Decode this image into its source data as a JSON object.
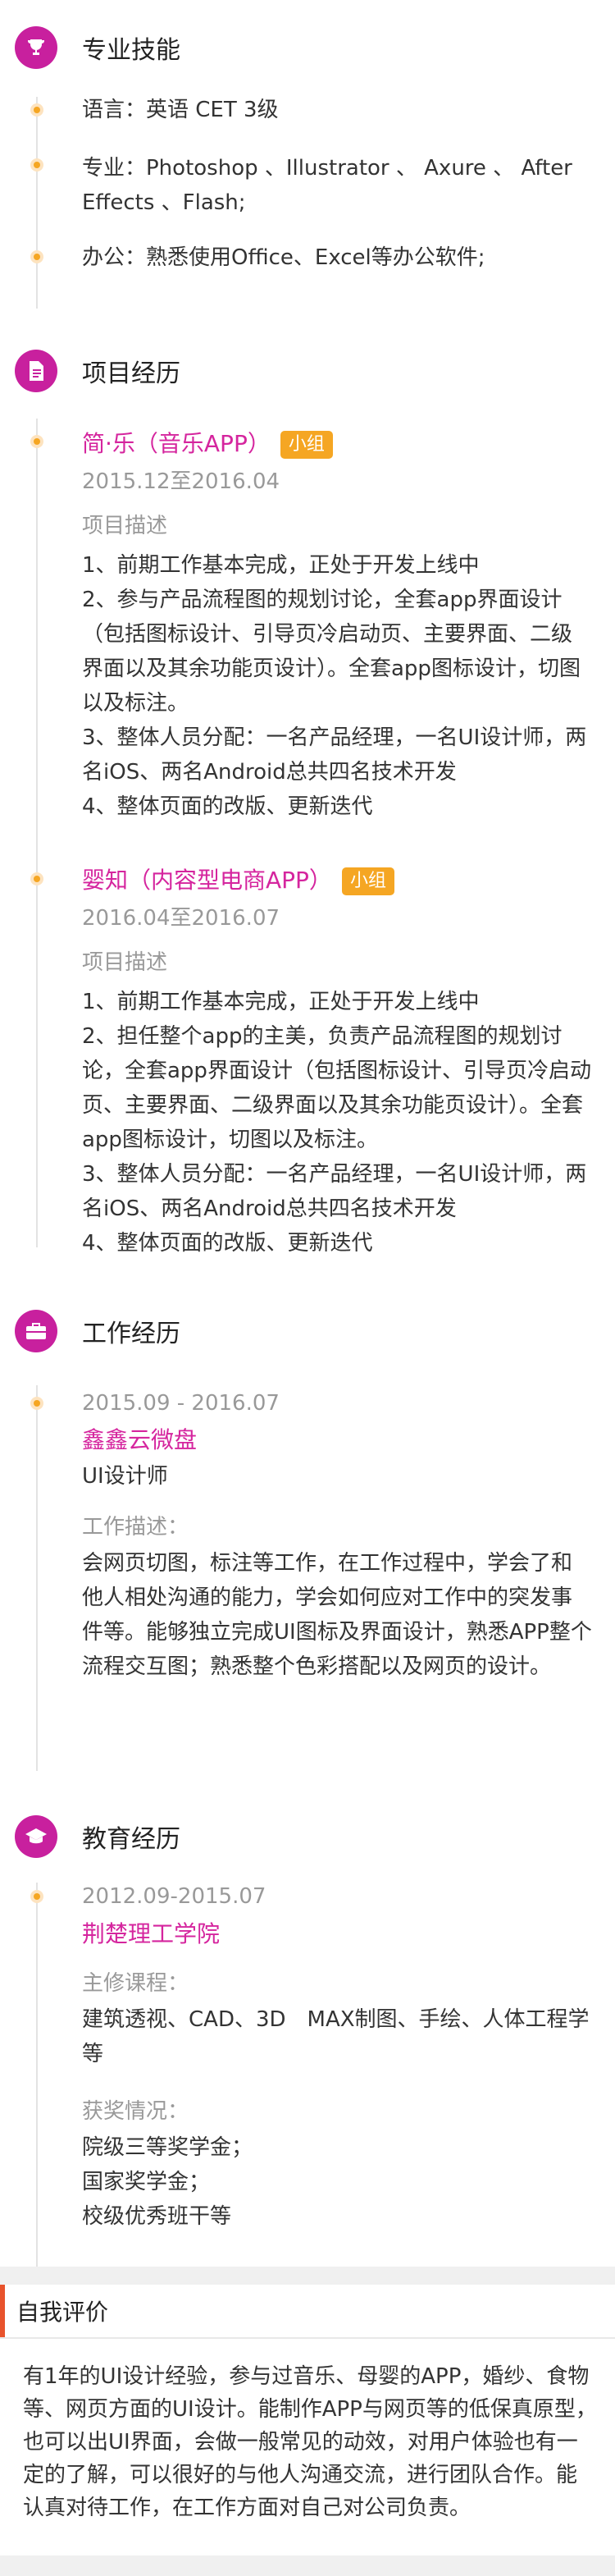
{
  "skills": {
    "title": "专业技能",
    "icon": "trophy-icon",
    "items": [
      "语言：英语  CET 3级",
      "专业：Photoshop 、Illustrator 、 Axure 、 After Effects 、Flash;",
      "办公：熟悉使用Office、Excel等办公软件;"
    ]
  },
  "projects": {
    "title": "项目经历",
    "icon": "document-icon",
    "items": [
      {
        "name": "简·乐（音乐APP）",
        "tag": "小组",
        "date": "2015.12至2016.04",
        "desc_label": "项目描述",
        "lines": [
          "1、前期工作基本完成，正处于开发上线中",
          "2、参与产品流程图的规划讨论，全套app界面设计（包括图标设计、引导页冷启动页、主要界面、二级界面以及其余功能页设计）。全套app图标设计，切图以及标注。",
          "3、整体人员分配：一名产品经理，一名UI设计师，两名iOS、两名Android总共四名技术开发",
          "4、整体页面的改版、更新迭代"
        ]
      },
      {
        "name": "婴知（内容型电商APP）",
        "tag": "小组",
        "date": "2016.04至2016.07",
        "desc_label": "项目描述",
        "lines": [
          "1、前期工作基本完成，正处于开发上线中",
          "2、担任整个app的主美，负责产品流程图的规划讨论，全套app界面设计（包括图标设计、引导页冷启动页、主要界面、二级界面以及其余功能页设计）。全套app图标设计，切图以及标注。",
          "3、整体人员分配：一名产品经理，一名UI设计师，两名iOS、两名Android总共四名技术开发",
          "4、整体页面的改版、更新迭代"
        ]
      }
    ]
  },
  "work": {
    "title": "工作经历",
    "icon": "briefcase-icon",
    "date": "2015.09 - 2016.07",
    "company": "鑫鑫云微盘",
    "role": "UI设计师",
    "desc_label": "工作描述：",
    "desc": "会网页切图，标注等工作，在工作过程中，学会了和他人相处沟通的能力，学会如何应对工作中的突发事件等。能够独立完成UI图标及界面设计，熟悉APP整个流程交互图；熟悉整个色彩搭配以及网页的设计。"
  },
  "education": {
    "title": "教育经历",
    "icon": "graduation-cap-icon",
    "date": "2012.09-2015.07",
    "school": "荆楚理工学院",
    "courses_label": "主修课程：",
    "courses": "建筑透视、CAD、3D　MAX制图、手绘、人体工程学等",
    "awards_label": "获奖情况：",
    "awards": [
      "院级三等奖学金；",
      "国家奖学金；",
      "校级优秀班干等"
    ]
  },
  "self_eval": {
    "title": "自我评价",
    "text": "有1年的UI设计经验，参与过音乐、母婴的APP，婚纱、食物等、网页方面的UI设计。能制作APP与网页等的低保真原型，也可以出UI界面，会做一般常见的动效，对用户体验也有一定的了解，可以很好的与他人沟通交流，进行团队合作。能认真对待工作，在工作方面对自己对公司负责。"
  }
}
